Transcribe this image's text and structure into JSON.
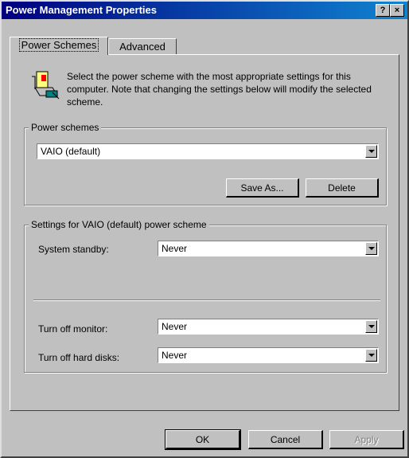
{
  "window": {
    "title": "Power Management Properties",
    "help_button": "?",
    "close_button": "×"
  },
  "tabs": [
    {
      "label": "Power Schemes",
      "selected": true
    },
    {
      "label": "Advanced",
      "selected": false
    }
  ],
  "description": "Select the power scheme with the most appropriate settings for this computer. Note that changing the settings below will modify the selected scheme.",
  "power_schemes": {
    "legend": "Power schemes",
    "selected": "VAIO (default)",
    "save_as_label": "Save As...",
    "delete_label": "Delete"
  },
  "settings": {
    "legend": "Settings for VAIO (default) power scheme",
    "system_standby": {
      "label": "System standby:",
      "value": "Never"
    },
    "turn_off_monitor": {
      "label": "Turn off monitor:",
      "value": "Never"
    },
    "turn_off_hard_disks": {
      "label": "Turn off hard disks:",
      "value": "Never"
    }
  },
  "footer": {
    "ok_label": "OK",
    "cancel_label": "Cancel",
    "apply_label": "Apply"
  }
}
